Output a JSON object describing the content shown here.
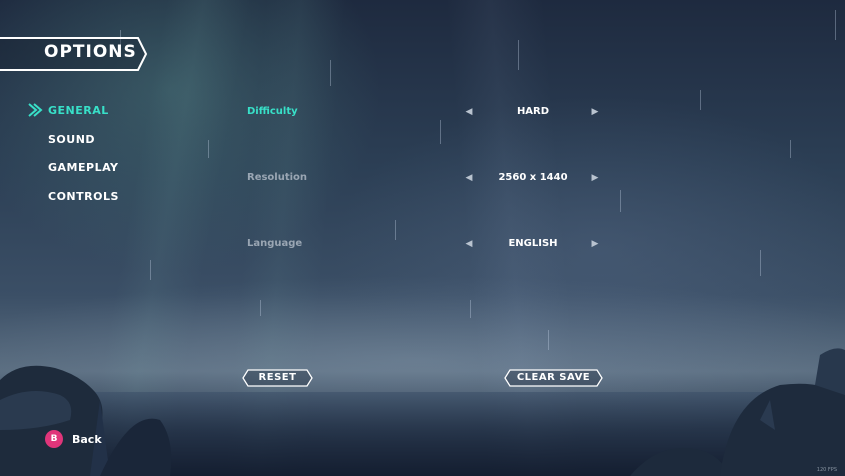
{
  "title": "OPTIONS",
  "nav": {
    "items": [
      {
        "label": "GENERAL",
        "active": true
      },
      {
        "label": "SOUND",
        "active": false
      },
      {
        "label": "GAMEPLAY",
        "active": false
      },
      {
        "label": "CONTROLS",
        "active": false
      }
    ]
  },
  "settings": [
    {
      "label": "Difficulty",
      "value": "HARD",
      "active": true
    },
    {
      "label": "Resolution",
      "value": "2560 x 1440",
      "active": false
    },
    {
      "label": "Language",
      "value": "ENGLISH",
      "active": false
    }
  ],
  "buttons": {
    "reset": "RESET",
    "clear_save": "CLEAR SAVE"
  },
  "back": {
    "glyph": "B",
    "label": "Back"
  },
  "fps_text": "120 FPS",
  "colors": {
    "accent": "#38e0c8",
    "back_button": "#e0357a"
  },
  "icons": {
    "left_arrow": "left-arrow-icon",
    "right_arrow": "right-arrow-icon",
    "selection": "selection-arrow-icon"
  }
}
